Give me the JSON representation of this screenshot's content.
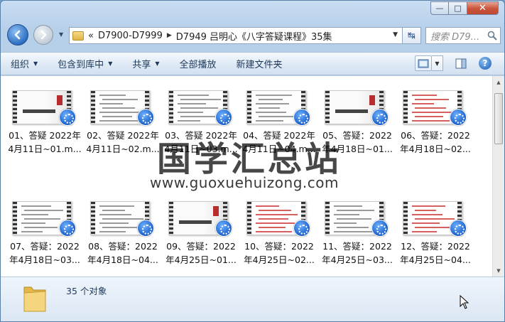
{
  "window": {
    "minimize_glyph": "—",
    "maximize_glyph": "□",
    "close_glyph": "✕"
  },
  "nav": {
    "address_prefix": "«",
    "breadcrumbs": [
      "D7900-D7999",
      "D7949 吕明心《八字答疑课程》35集"
    ],
    "search_placeholder": "搜索 D79...",
    "refresh_glyph": "↹"
  },
  "toolbar": {
    "items": [
      {
        "label": "组织",
        "dropdown": true
      },
      {
        "label": "包含到库中",
        "dropdown": true
      },
      {
        "label": "共享",
        "dropdown": true
      },
      {
        "label": "全部播放",
        "dropdown": false
      },
      {
        "label": "新建文件夹",
        "dropdown": false
      }
    ],
    "help_glyph": "?"
  },
  "files": [
    {
      "line1": "01、答疑 2022年",
      "line2": "4月11日~01.m...",
      "thumb": "title"
    },
    {
      "line1": "02、答疑 2022年",
      "line2": "4月11日~02.m...",
      "thumb": "notes"
    },
    {
      "line1": "03、答疑 2022年",
      "line2": "4月11日~03.m...",
      "thumb": "notes"
    },
    {
      "line1": "04、答疑 2022年",
      "line2": "4月11日~04.m...",
      "thumb": "notes"
    },
    {
      "line1": "05、答疑：2022",
      "line2": "年4月18日~01...",
      "thumb": "title"
    },
    {
      "line1": "06、答疑：2022",
      "line2": "年4月18日~02...",
      "thumb": "red"
    },
    {
      "line1": "07、答疑：2022",
      "line2": "年4月18日~03...",
      "thumb": "notes"
    },
    {
      "line1": "08、答疑：2022",
      "line2": "年4月18日~04...",
      "thumb": "notes"
    },
    {
      "line1": "09、答疑：2022",
      "line2": "年4月25日~01...",
      "thumb": "title"
    },
    {
      "line1": "10、答疑：2022",
      "line2": "年4月25日~02...",
      "thumb": "red"
    },
    {
      "line1": "11、答疑：2022",
      "line2": "年4月25日~03...",
      "thumb": "notes"
    },
    {
      "line1": "12、答疑：2022",
      "line2": "年4月25日~04...",
      "thumb": "red"
    }
  ],
  "watermark": {
    "cn": "国学汇总站",
    "url": "www.guoxuehuizong.com"
  },
  "details": {
    "count": "35 个对象"
  }
}
